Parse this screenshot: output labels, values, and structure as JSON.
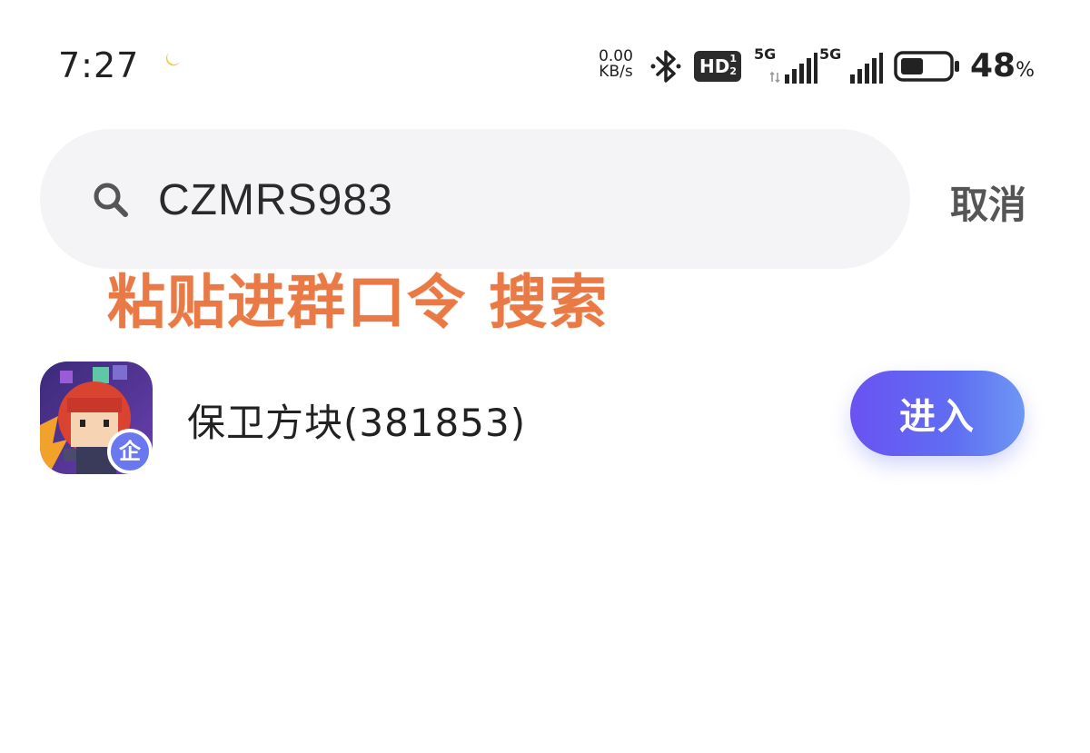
{
  "status_bar": {
    "time": "7:27",
    "net_speed_value": "0.00",
    "net_speed_unit": "KB/s",
    "hd_label": "HD",
    "hd_top": "1",
    "hd_bottom": "2",
    "sim1_network": "5G",
    "sim2_network": "5G",
    "battery_percent": "48",
    "battery_percent_sign": "%",
    "battery_level": 0.48
  },
  "search": {
    "query": "CZMRS983",
    "placeholder": "",
    "cancel_label": "取消"
  },
  "overlay": {
    "hint_text": "粘贴进群口令 搜索",
    "hint_color": "#ea7a45"
  },
  "result": {
    "group_name": "保卫方块(381853)",
    "badge_label": "企",
    "enter_label": "进入",
    "button_gradient": [
      "#6a52f2",
      "#6e97f4"
    ]
  }
}
